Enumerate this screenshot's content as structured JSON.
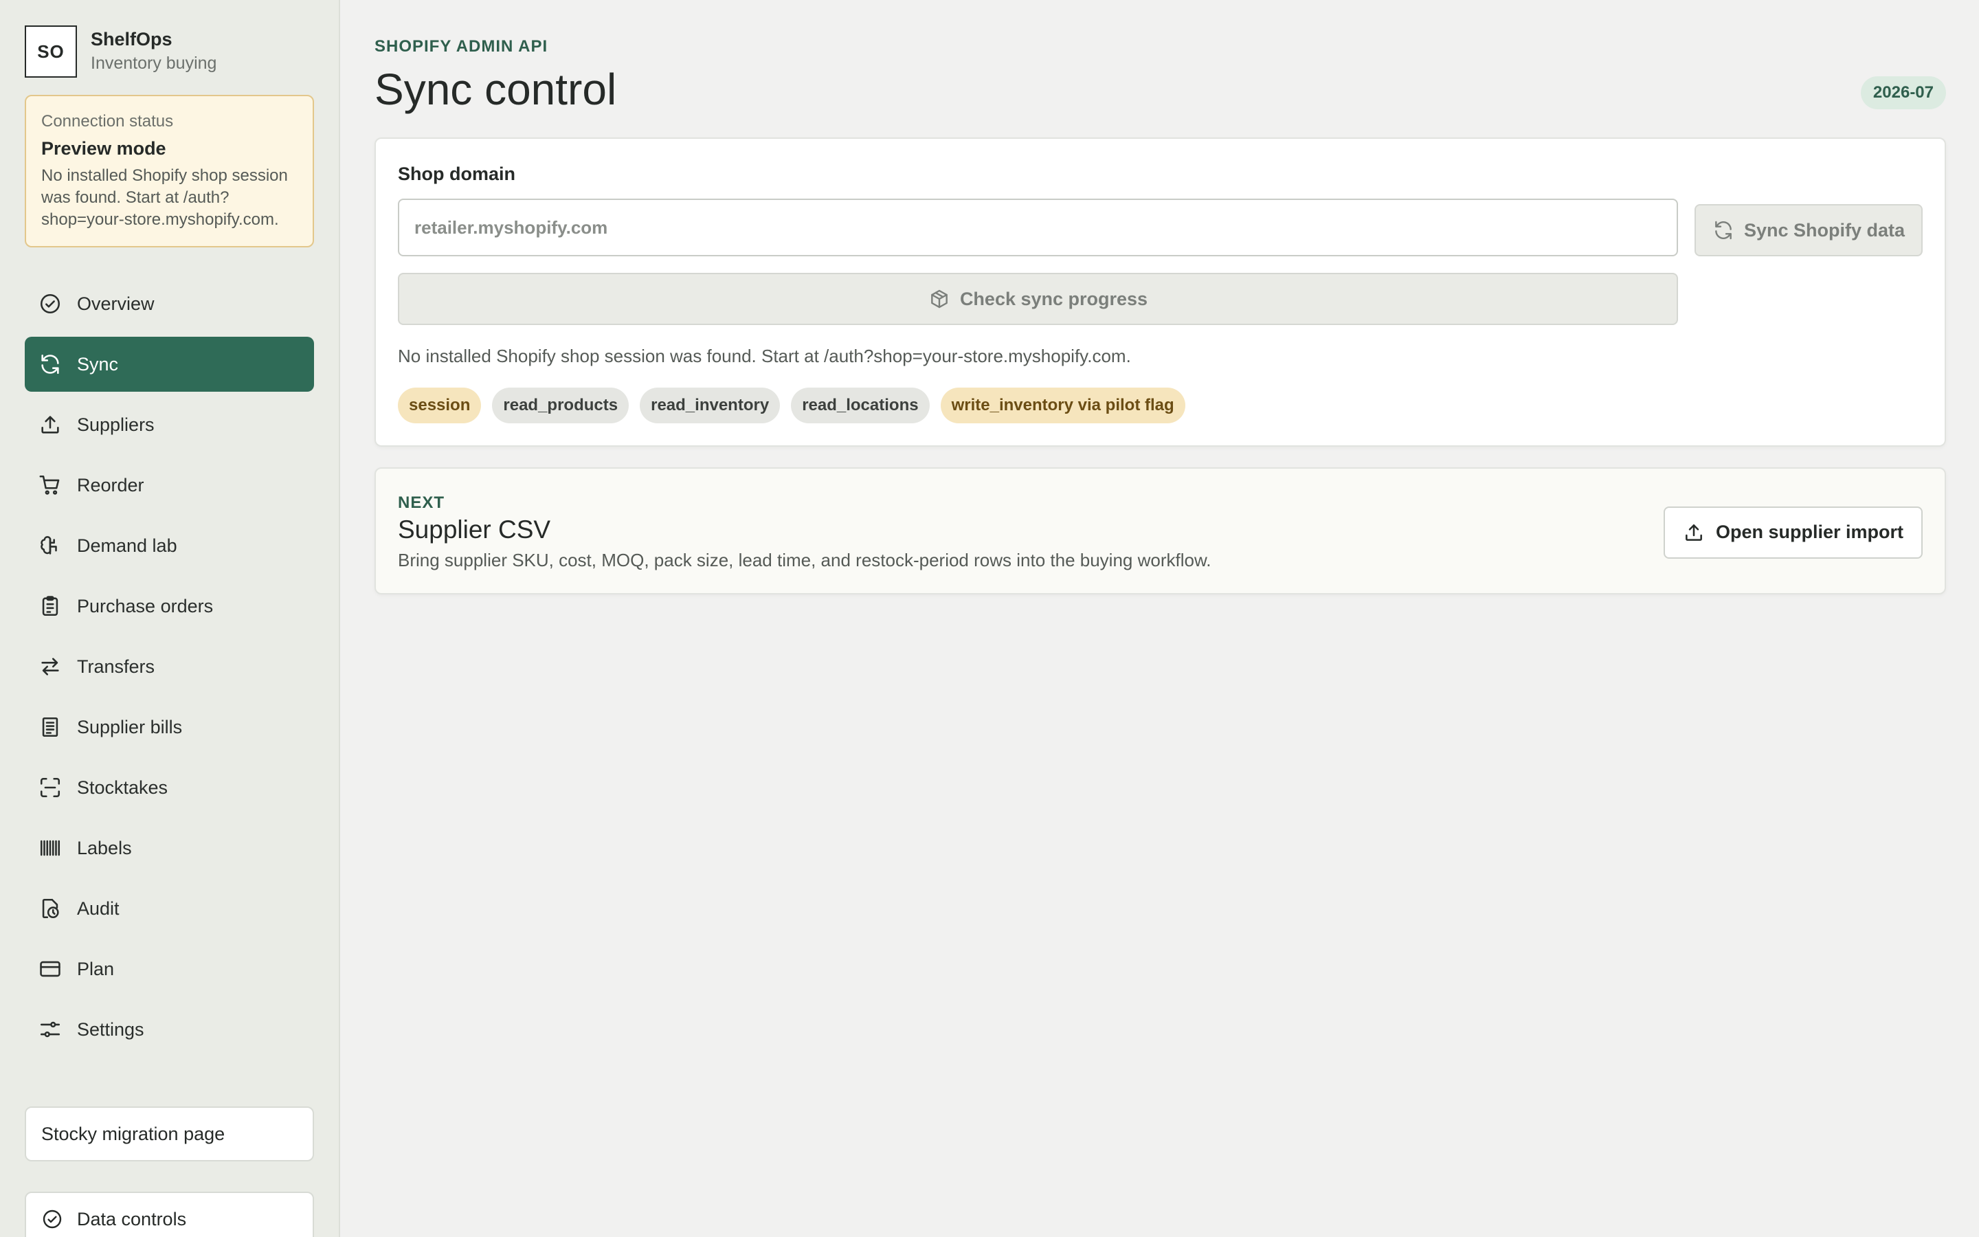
{
  "brand": {
    "logo_text": "SO",
    "name": "ShelfOps",
    "subtitle": "Inventory buying"
  },
  "connection": {
    "label": "Connection status",
    "mode": "Preview mode",
    "message": "No installed Shopify shop session was found. Start at /auth?shop=your-store.myshopify.com."
  },
  "nav": {
    "items": [
      {
        "label": "Overview",
        "icon": "check-circle-icon"
      },
      {
        "label": "Sync",
        "icon": "refresh-icon",
        "active": true
      },
      {
        "label": "Suppliers",
        "icon": "upload-icon"
      },
      {
        "label": "Reorder",
        "icon": "cart-icon"
      },
      {
        "label": "Demand lab",
        "icon": "brain-icon"
      },
      {
        "label": "Purchase orders",
        "icon": "clipboard-icon"
      },
      {
        "label": "Transfers",
        "icon": "arrows-swap-icon"
      },
      {
        "label": "Supplier bills",
        "icon": "receipt-icon"
      },
      {
        "label": "Stocktakes",
        "icon": "scan-icon"
      },
      {
        "label": "Labels",
        "icon": "barcode-icon"
      },
      {
        "label": "Audit",
        "icon": "file-clock-icon"
      },
      {
        "label": "Plan",
        "icon": "credit-card-icon"
      },
      {
        "label": "Settings",
        "icon": "sliders-icon"
      }
    ],
    "migration_label": "Stocky migration page",
    "bottom_label": "Data controls"
  },
  "header": {
    "eyebrow": "SHOPIFY ADMIN API",
    "title": "Sync control",
    "version": "2026-07"
  },
  "sync": {
    "field_label": "Shop domain",
    "input_placeholder": "retailer.myshopify.com",
    "input_value": "",
    "sync_button": "Sync Shopify data",
    "progress_button": "Check sync progress",
    "session_message": "No installed Shopify shop session was found. Start at /auth?shop=your-store.myshopify.com.",
    "scopes": [
      {
        "label": "session",
        "tone": "warn"
      },
      {
        "label": "read_products",
        "tone": "neutral"
      },
      {
        "label": "read_inventory",
        "tone": "neutral"
      },
      {
        "label": "read_locations",
        "tone": "neutral"
      },
      {
        "label": "write_inventory via pilot flag",
        "tone": "warn"
      }
    ]
  },
  "next": {
    "eyebrow": "NEXT",
    "title": "Supplier CSV",
    "description": "Bring supplier SKU, cost, MOQ, pack size, lead time, and restock-period rows into the buying workflow.",
    "button": "Open supplier import"
  },
  "colors": {
    "accent": "#2f6b57",
    "warning_bg": "#fdf6e3",
    "chip_warn": "#f6e5bd"
  }
}
